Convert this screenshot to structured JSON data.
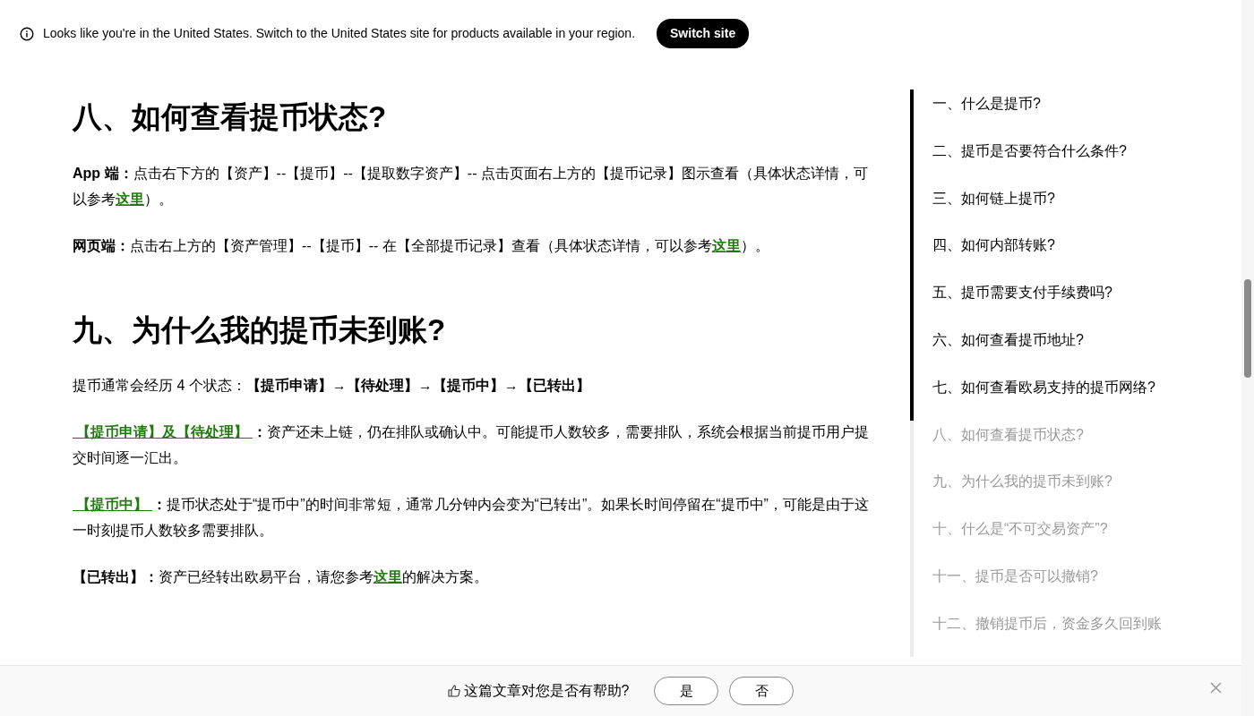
{
  "banner": {
    "message": "Looks like you're in the United States. Switch to the United States site for products available in your region.",
    "button": "Switch site"
  },
  "article": [
    {
      "kind": "heading",
      "text": "八、如何查看提币状态?"
    },
    {
      "kind": "paragraph",
      "parts": [
        {
          "kind": "bold",
          "text": "App 端："
        },
        {
          "kind": "plain",
          "text": "点击右下方的【资产】--【提币】--【提取数字资产】-- 点击页面右上方的【提币记录】图示查看（具体状态详情，可以参考"
        },
        {
          "kind": "link",
          "text": "这里"
        },
        {
          "kind": "plain",
          "text": "）。"
        }
      ]
    },
    {
      "kind": "paragraph",
      "parts": [
        {
          "kind": "bold",
          "text": "网页端："
        },
        {
          "kind": "plain",
          "text": "点击右上方的【资产管理】--【提币】-- 在【全部提币记录】查看（具体状态详情，可以参考"
        },
        {
          "kind": "link",
          "text": "这里"
        },
        {
          "kind": "plain",
          "text": "）。"
        }
      ]
    },
    {
      "kind": "heading",
      "text": "九、为什么我的提币未到账?"
    },
    {
      "kind": "paragraph",
      "parts": [
        {
          "kind": "plain",
          "text": "提币通常会经历 4 个状态："
        },
        {
          "kind": "bold",
          "text": "【提币申请】→【待处理】→【提币中】→【已转出】"
        }
      ]
    },
    {
      "kind": "paragraph",
      "parts": [
        {
          "kind": "link",
          "text": " 【提币申请】及【待处理】 "
        },
        {
          "kind": "bold",
          "text": "："
        },
        {
          "kind": "plain",
          "text": "资产还未上链，仍在排队或确认中。可能提币人数较多，需要排队，系统会根据当前提币用户提交时间逐一汇出。"
        }
      ]
    },
    {
      "kind": "paragraph",
      "parts": [
        {
          "kind": "link",
          "text": " 【提币中】 "
        },
        {
          "kind": "bold",
          "text": "："
        },
        {
          "kind": "plain",
          "text": "提币状态处于“提币中”的时间非常短，通常几分钟内会变为“已转出”。如果长时间停留在“提币中”，可能是由于这一时刻提币人数较多需要排队。"
        }
      ]
    },
    {
      "kind": "paragraph",
      "parts": [
        {
          "kind": "bold",
          "text": "【已转出】："
        },
        {
          "kind": "plain",
          "text": "资产已经转出欧易平台，请您参考"
        },
        {
          "kind": "link",
          "text": "这里"
        },
        {
          "kind": "plain",
          "text": "的解决方案。"
        }
      ]
    }
  ],
  "toc": [
    {
      "text": "一、什么是提币?",
      "passed": true
    },
    {
      "text": "二、提币是否要符合什么条件?",
      "passed": true
    },
    {
      "text": "三、如何链上提币?",
      "passed": true
    },
    {
      "text": "四、如何内部转账?",
      "passed": true
    },
    {
      "text": "五、提币需要支付手续费吗?",
      "passed": true
    },
    {
      "text": "六、如何查看提币地址?",
      "passed": true
    },
    {
      "text": "七、如何查看欧易支持的提币网络?",
      "passed": true
    },
    {
      "text": "八、如何查看提币状态?",
      "passed": false
    },
    {
      "text": "九、为什么我的提币未到账?",
      "passed": false
    },
    {
      "text": "十、什么是“不可交易资产”?",
      "passed": false
    },
    {
      "text": "十一、提币是否可以撤销?",
      "passed": false
    },
    {
      "text": "十二、撤销提币后，资金多久回到账",
      "passed": false
    }
  ],
  "feedback": {
    "question": "这篇文章对您是否有帮助?",
    "yes": "是",
    "no": "否"
  }
}
